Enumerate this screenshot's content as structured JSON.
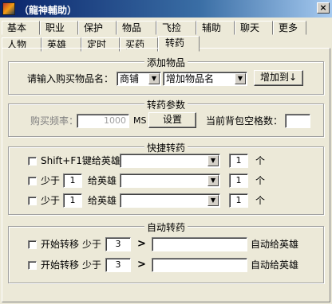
{
  "window": {
    "title": "（龍神輔助）",
    "close_label": "×"
  },
  "tabs_row1": [
    "基本",
    "职业",
    "保护",
    "物品",
    "飞捡",
    "辅助",
    "聊天",
    "更多"
  ],
  "tabs_row2": [
    "人物",
    "英雄",
    "定时",
    "买药",
    "转药"
  ],
  "add_item": {
    "title": "添加物品",
    "prompt": "请输入购买物品名：",
    "shop_value": "商铺",
    "item_value": "增加物品名",
    "add_button": "增加到↓"
  },
  "transfer_params": {
    "title": "转药参数",
    "freq_label": "购买频率：",
    "freq_value": "1000",
    "unit": "MS",
    "set_button": "设置",
    "bag_label": "当前背包空格数："
  },
  "quick_transfer": {
    "title": "快捷转药",
    "rows": [
      {
        "label": "Shift+F1键给英雄",
        "count": "1",
        "unit": "个"
      },
      {
        "label": "少于",
        "threshold": "1",
        "label2": "给英雄",
        "count": "1",
        "unit": "个"
      },
      {
        "label": "少于",
        "threshold": "1",
        "label2": "给英雄",
        "count": "1",
        "unit": "个"
      }
    ]
  },
  "auto_transfer": {
    "title": "自动转药",
    "rows": [
      {
        "label": "开始转移",
        "less_label": "少于",
        "value": "3",
        "arrow": ">",
        "suffix": "自动给英雄"
      },
      {
        "label": "开始转移",
        "less_label": "少于",
        "value": "3",
        "arrow": ">",
        "suffix": "自动给英雄"
      }
    ]
  }
}
